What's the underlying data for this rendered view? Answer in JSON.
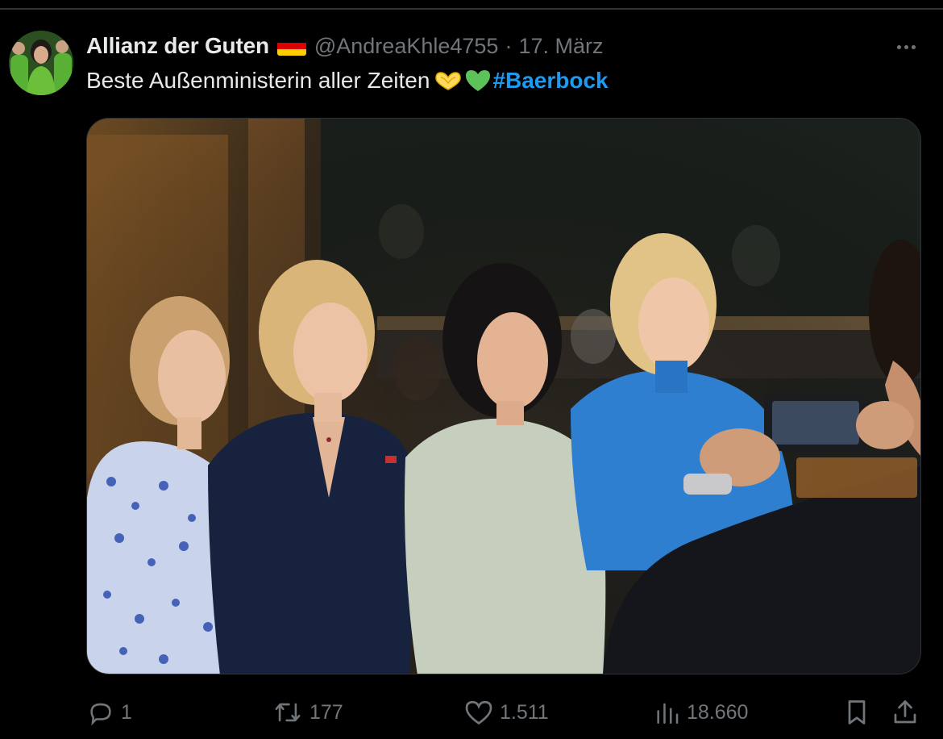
{
  "tweet": {
    "display_name": "Allianz der Guten",
    "handle": "@AndreaKhle4755",
    "separator": "·",
    "date": "17. März",
    "text": "Beste Außenministerin aller Zeiten",
    "hashtag": "#Baerbock",
    "emojis": [
      "heart-hands-emoji",
      "green-heart-emoji"
    ],
    "flag": "germany-flag"
  },
  "actions": {
    "replies": "1",
    "retweets": "177",
    "likes": "1.511",
    "views": "18.660"
  },
  "colors": {
    "background": "#000000",
    "text_primary": "#e7e9ea",
    "text_secondary": "#71767b",
    "link": "#1d9bf0",
    "border": "#2f3336"
  },
  "icons": [
    "more-icon",
    "reply-icon",
    "retweet-icon",
    "like-icon",
    "views-icon",
    "bookmark-icon",
    "share-icon"
  ]
}
